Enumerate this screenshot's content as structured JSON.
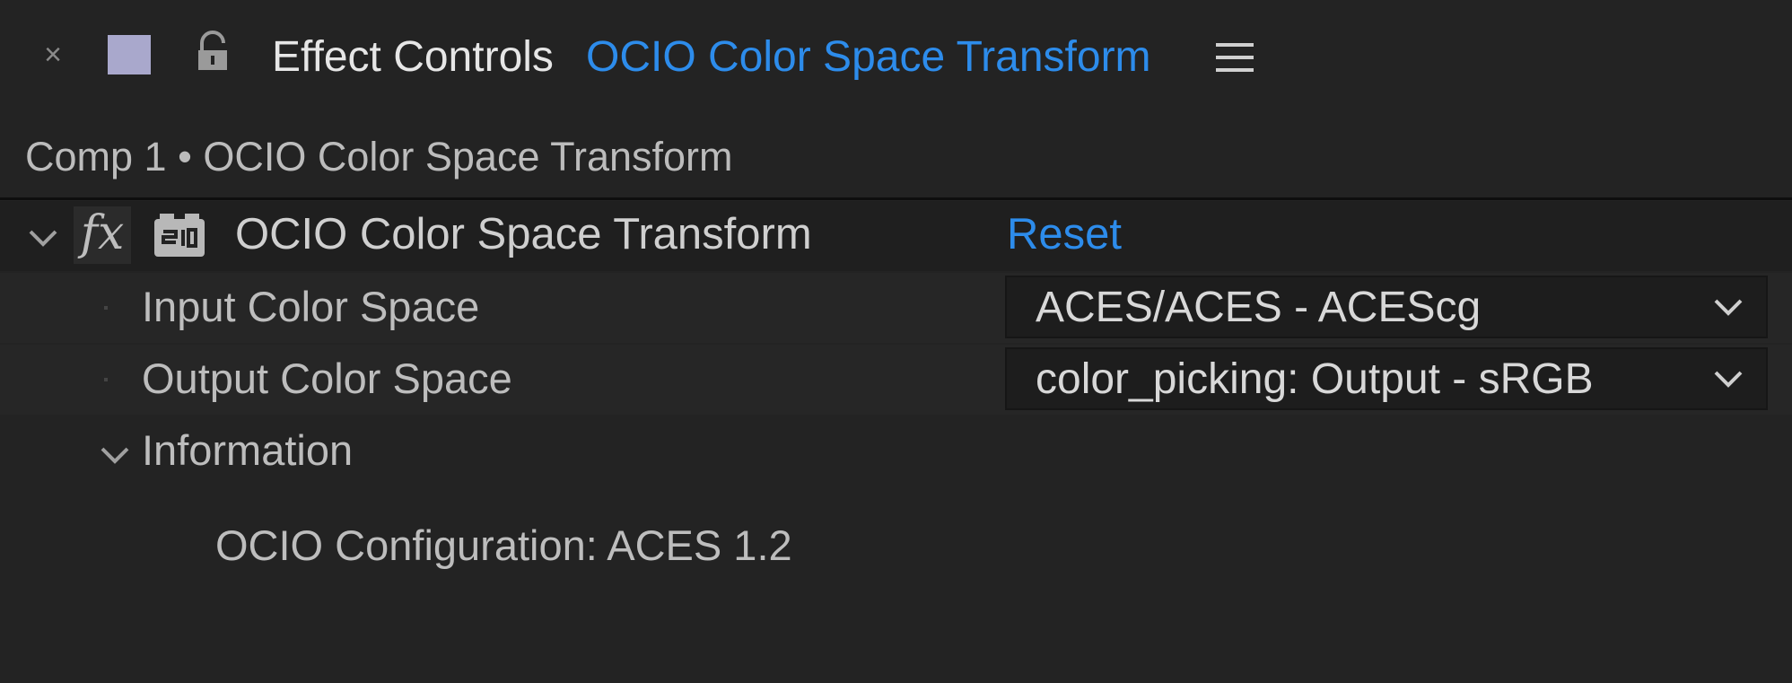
{
  "panel": {
    "tab_title": "Effect Controls",
    "tab_effect": "OCIO Color Space Transform",
    "close_glyph": "×",
    "label_color": "#a9a8cc",
    "accent_color": "#2d8ceb"
  },
  "breadcrumb": "Comp 1 • OCIO Color Space Transform",
  "effect": {
    "fx_label": "fx",
    "name": "OCIO Color Space Transform",
    "reset_label": "Reset",
    "params": [
      {
        "label": "Input Color Space",
        "value": "ACES/ACES - ACEScg"
      },
      {
        "label": "Output Color Space",
        "value": "color_picking: Output - sRGB"
      }
    ],
    "information": {
      "label": "Information",
      "text": "OCIO Configuration: ACES 1.2"
    }
  },
  "icons": [
    "close-icon",
    "label-color-swatch",
    "lock-icon",
    "panel-menu-icon",
    "chevron-down-icon",
    "fx-icon",
    "effect-preset-icon",
    "dropdown-caret-icon"
  ]
}
